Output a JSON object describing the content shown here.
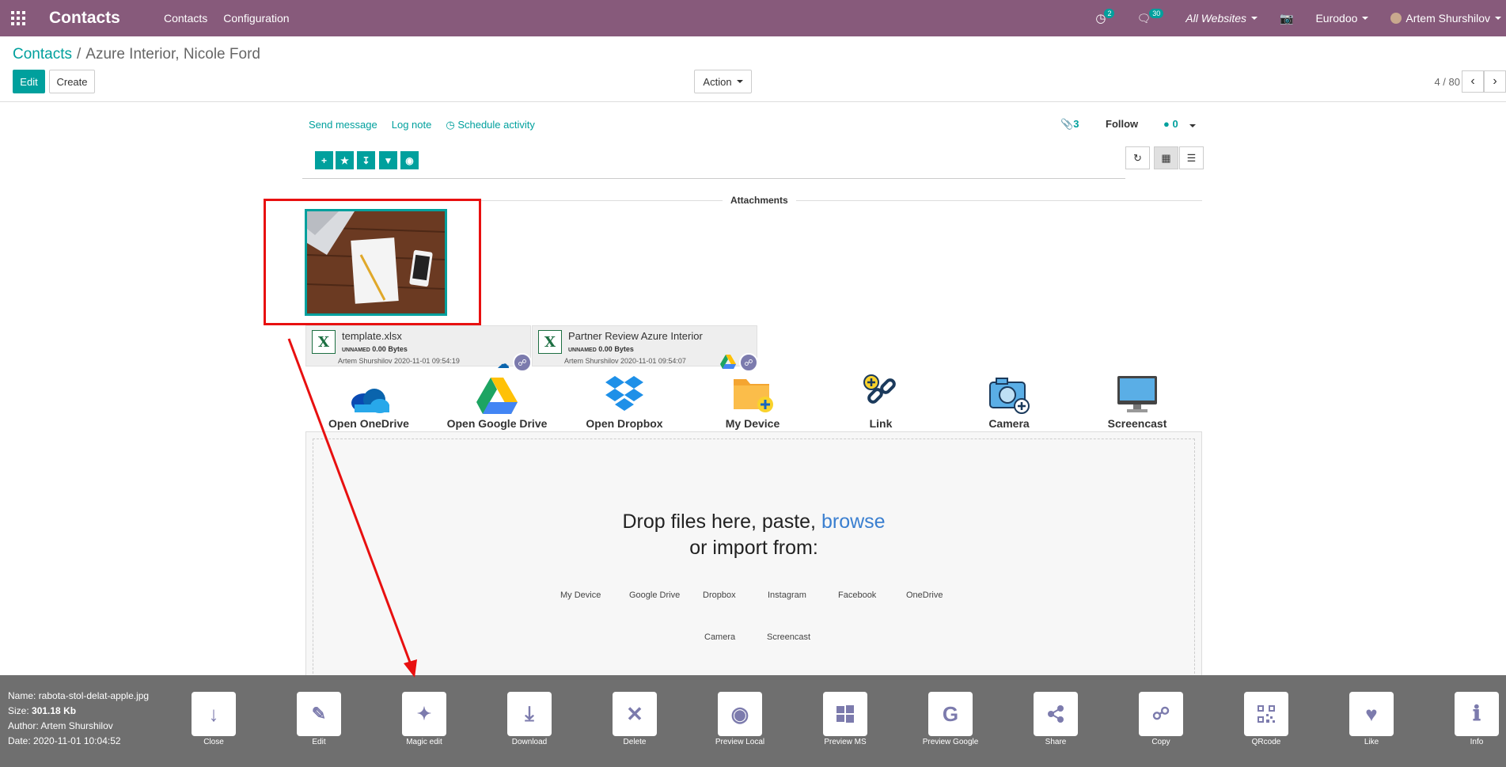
{
  "topbar": {
    "app_title": "Contacts",
    "menu": [
      "Contacts",
      "Configuration"
    ],
    "activity_count": "2",
    "messages_count": "30",
    "websites": "All Websites",
    "company": "Eurodoo",
    "user": "Artem Shurshilov",
    "bg_color": "#875a7b"
  },
  "breadcrumb": {
    "root": "Contacts",
    "separator": "/",
    "current": "Azure Interior, Nicole Ford"
  },
  "controls": {
    "edit": "Edit",
    "create": "Create",
    "action": "Action",
    "pager": "4 / 80"
  },
  "chatter": {
    "send_message": "Send message",
    "log_note": "Log note",
    "schedule_activity": "Schedule activity",
    "attachments_count": "3",
    "follow": "Follow",
    "followers_count": "0"
  },
  "attachments": {
    "title": "Attachments",
    "files": [
      {
        "name": "template.xlsx",
        "tag": "UNNAMED",
        "size": "0.00 Bytes",
        "author_date": "Artem Shurshilov 2020-11-01 09:54:19"
      },
      {
        "name": "Partner Review Azure Interior",
        "tag": "UNNAMED",
        "size": "0.00 Bytes",
        "author_date": "Artem Shurshilov 2020-11-01 09:54:07"
      }
    ]
  },
  "sources": [
    {
      "label": "Open OneDrive",
      "icon": "onedrive-icon"
    },
    {
      "label": "Open Google Drive",
      "icon": "google-drive-icon"
    },
    {
      "label": "Open Dropbox",
      "icon": "dropbox-icon"
    },
    {
      "label": "My Device",
      "icon": "folder-icon"
    },
    {
      "label": "Link",
      "icon": "link-icon"
    },
    {
      "label": "Camera",
      "icon": "camera-icon"
    },
    {
      "label": "Screencast",
      "icon": "monitor-icon"
    }
  ],
  "dropzone": {
    "line1": "Drop files here, paste,",
    "browse": "browse",
    "line2": "or import from:",
    "import_row1": [
      "My Device",
      "Google Drive",
      "Dropbox",
      "Instagram",
      "Facebook",
      "OneDrive"
    ],
    "import_row2": [
      "Camera",
      "Screencast"
    ]
  },
  "preview": {
    "name_label": "Name:",
    "name": "rabota-stol-delat-apple.jpg",
    "size_label": "Size:",
    "size": "301.18 Kb",
    "author_label": "Author:",
    "author": "Artem Shurshilov",
    "date_label": "Date:",
    "date": "2020-11-01 10:04:52",
    "buttons": [
      "Close",
      "Edit",
      "Magic edit",
      "Download",
      "Delete",
      "Preview Local",
      "Preview MS",
      "Preview Google",
      "Share",
      "Copy",
      "QRcode",
      "Like",
      "Info"
    ]
  }
}
